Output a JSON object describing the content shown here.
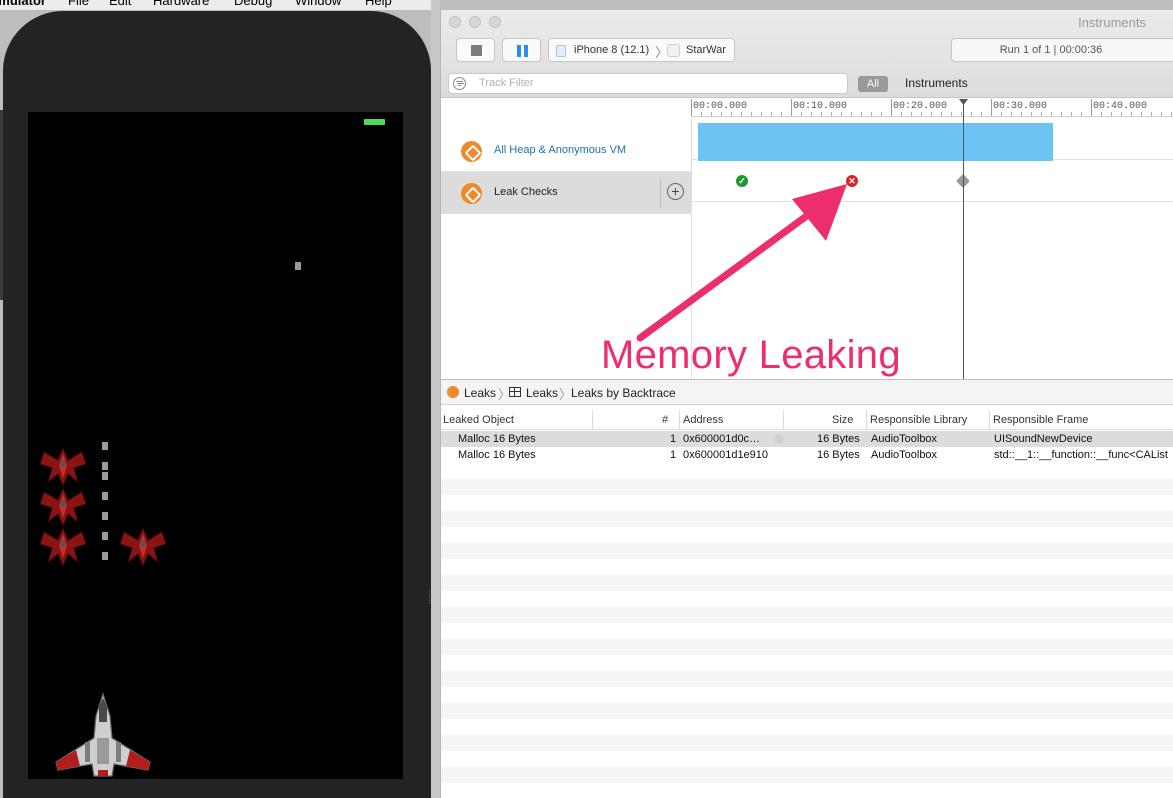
{
  "menubar": {
    "app": "Simulator",
    "items": [
      "File",
      "Edit",
      "Hardware",
      "Debug",
      "Window",
      "Help"
    ]
  },
  "window": {
    "title": "Instruments",
    "device": "iPhone 8 (12.1)",
    "app": "StarWar",
    "run_info": "Run 1 of 1  |  00:00:36",
    "filter_placeholder": "Track Filter",
    "all_label": "All",
    "instruments_label": "Instruments"
  },
  "ruler": {
    "labels": [
      "00:00.000",
      "00:10.000",
      "00:20.000",
      "00:30.000",
      "00:40.000"
    ]
  },
  "tracks": [
    {
      "name": "All Heap & Anonymous VM",
      "color": "#1f6fa8",
      "selected": false
    },
    {
      "name": "Leak Checks",
      "color": "#222222",
      "selected": true
    }
  ],
  "leak_checks": [
    {
      "status": "ok",
      "glyph": "✓"
    },
    {
      "status": "leak",
      "glyph": "✕"
    },
    {
      "status": "pending",
      "glyph": ""
    }
  ],
  "annotation": {
    "text": "Memory Leaking",
    "color": "#ec2f6c"
  },
  "jumpbar": {
    "items": [
      "Leaks",
      "Leaks",
      "Leaks by Backtrace"
    ]
  },
  "table": {
    "columns": [
      "Leaked Object",
      "#",
      "Address",
      "Size",
      "Responsible Library",
      "Responsible Frame"
    ],
    "rows": [
      {
        "object": "Malloc 16 Bytes",
        "count": "1",
        "address": "0x600001d0c…",
        "size": "16 Bytes",
        "library": "AudioToolbox",
        "frame": "UISoundNewDevice"
      },
      {
        "object": "Malloc 16 Bytes",
        "count": "1",
        "address": "0x600001d1e910",
        "size": "16 Bytes",
        "library": "AudioToolbox",
        "frame": "std::__1::__function::__func<CAList"
      }
    ]
  },
  "colors": {
    "heap_fill": "#6cc3f4",
    "leak_ok": "#1a9a2f",
    "leak_bad": "#dd2222",
    "instrument_icon": "#f0892c",
    "battery": "#4cd964"
  }
}
